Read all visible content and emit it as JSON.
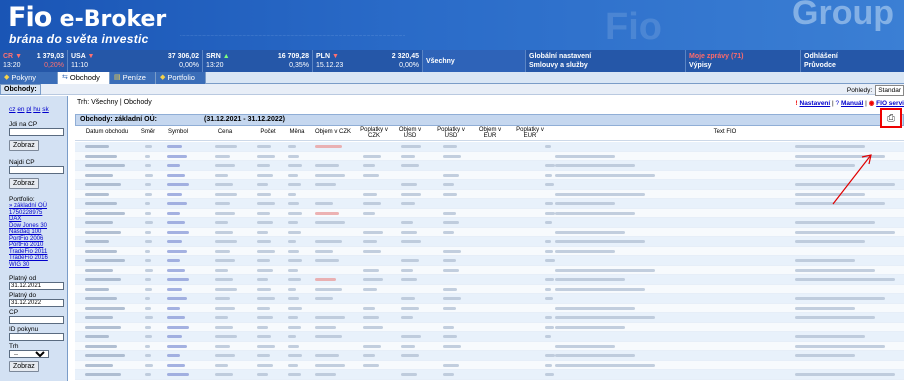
{
  "header": {
    "logo_main": "Fio",
    "logo_sub": "e-Broker",
    "slogan": "brána do světa investic",
    "group_label": "Group"
  },
  "quotes": [
    {
      "name": "CR",
      "value": "1 379,03",
      "change": "0,20%",
      "time": "13:20"
    },
    {
      "name": "USA",
      "value": "37 306,02",
      "change": "0,00%",
      "time": "11:10"
    },
    {
      "name": "SRN",
      "value": "16 709,28",
      "change": "0,35%",
      "time": "13:20"
    },
    {
      "name": "PLN",
      "value": "2 320,45",
      "change": "0,00%",
      "time": "15.12.23"
    }
  ],
  "market_selector": "Všechny",
  "menu": {
    "global_settings": "Globální nastavení",
    "contracts": "Smlouvy a služby",
    "messages": "Moje zprávy (71)",
    "statements": "Výpisy",
    "logout": "Odhlášení",
    "guide": "Průvodce"
  },
  "tabs": [
    {
      "label": "Pokyny"
    },
    {
      "label": "Obchody"
    },
    {
      "label": "Peníze"
    },
    {
      "label": "Portfolio"
    }
  ],
  "subbar": {
    "label": "Obchody:",
    "views_label": "Pohledy:",
    "views_value": "Standar"
  },
  "sidebar": {
    "langs": [
      "cz",
      "en",
      "pl",
      "hu",
      "sk"
    ],
    "cp_label": "Jdi na CP",
    "show_btn": "Zobraz",
    "find_label": "Najdi CP",
    "find_btn": "Zobraz",
    "portfolio_label": "Portfolio:",
    "portfolio_items": [
      "» základní OÚ",
      "1750228975",
      "DAX",
      "Dow Jones 30",
      "Nasdaq 100",
      "PortFio 2006",
      "PortFio 2010",
      "TradeFio 2011",
      "TradeFio 2016",
      "WIG 30"
    ],
    "from_label": "Platný od",
    "from_value": "31.12.2021",
    "to_label": "Platný do",
    "to_value": "31.12.2022",
    "cp_field_label": "CP",
    "order_id_label": "ID pokynu",
    "type_label": "Trh",
    "type_value": "--",
    "submit_btn": "Zobraz"
  },
  "main": {
    "breadcrumb": "Trh: Všechny | Obchody",
    "settings_link": "Nastavení",
    "manual_link": "Manuál",
    "service_link": "FIO servi",
    "table_title": "Obchody: základní OÚ:",
    "table_dates": "(31.12.2021 - 31.12.2022)",
    "columns": [
      "Datum obchodu",
      "Směr",
      "Symbol",
      "Cena",
      "Počet",
      "Měna",
      "Objem v CZK",
      "Poplatky v CZK",
      "Objem v USD",
      "Poplatky v USD",
      "Objem v EUR",
      "Poplatky v EUR",
      "Text FIO"
    ],
    "pdf_icon": "pdf-export-icon"
  },
  "colors": {
    "header_blue": "#1a55b5",
    "quote_bar": "#2557a8",
    "highlight_red": "#e00000"
  }
}
